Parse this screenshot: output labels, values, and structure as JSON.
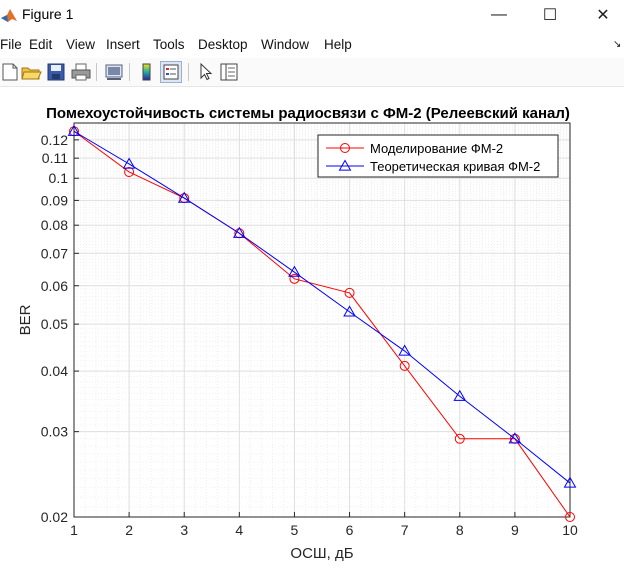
{
  "window": {
    "title": "Figure 1",
    "minimize_glyph": "—",
    "maximize_glyph": "☐",
    "close_glyph": "✕"
  },
  "menu": [
    "File",
    "Edit",
    "View",
    "Insert",
    "Tools",
    "Desktop",
    "Window",
    "Help"
  ],
  "menu_overflow_glyph": "↘",
  "toolbar": {
    "icons": [
      "new-figure-icon",
      "open-file-icon",
      "save-icon",
      "print-icon",
      "link-plot-icon",
      "insert-colorbar-icon",
      "insert-legend-icon",
      "pointer-icon",
      "property-inspector-icon"
    ]
  },
  "colors": {
    "series1": "#ff0000",
    "series2": "#0000ff",
    "grid": "#dedede",
    "axis": "#262626"
  },
  "chart_data": {
    "type": "line",
    "title": "Помехоустойчивость системы радиосвязи с ФМ-2 (Релеевский канал)",
    "xlabel": "ОСШ, дБ",
    "ylabel": "BER",
    "xlim": [
      1,
      10
    ],
    "ylim": [
      0.02,
      0.13
    ],
    "yscale": "log",
    "grid": true,
    "minor_grid": true,
    "legend_position": "top-right",
    "x": [
      1,
      2,
      3,
      4,
      5,
      6,
      7,
      8,
      9,
      10
    ],
    "xticks": [
      "1",
      "2",
      "3",
      "4",
      "5",
      "6",
      "7",
      "8",
      "9",
      "10"
    ],
    "yticks": [
      {
        "value": 0.02,
        "label": "0.02"
      },
      {
        "value": 0.03,
        "label": "0.03"
      },
      {
        "value": 0.04,
        "label": "0.04"
      },
      {
        "value": 0.05,
        "label": "0.05"
      },
      {
        "value": 0.06,
        "label": "0.06"
      },
      {
        "value": 0.07,
        "label": "0.07"
      },
      {
        "value": 0.08,
        "label": "0.08"
      },
      {
        "value": 0.09,
        "label": "0.09"
      },
      {
        "value": 0.1,
        "label": "0.1"
      },
      {
        "value": 0.11,
        "label": "0.11"
      },
      {
        "value": 0.12,
        "label": "0.12"
      }
    ],
    "series": [
      {
        "name": "Моделирование ФМ-2",
        "color": "#ff0000",
        "marker": "circle",
        "values": [
          0.125,
          0.103,
          0.091,
          0.077,
          0.062,
          0.058,
          0.041,
          0.029,
          0.029,
          0.02
        ]
      },
      {
        "name": "Теоретическая кривая ФМ-2",
        "color": "#0000ff",
        "marker": "triangle",
        "values": [
          0.125,
          0.107,
          0.091,
          0.077,
          0.064,
          0.053,
          0.044,
          0.0355,
          0.029,
          0.0235
        ]
      }
    ]
  }
}
